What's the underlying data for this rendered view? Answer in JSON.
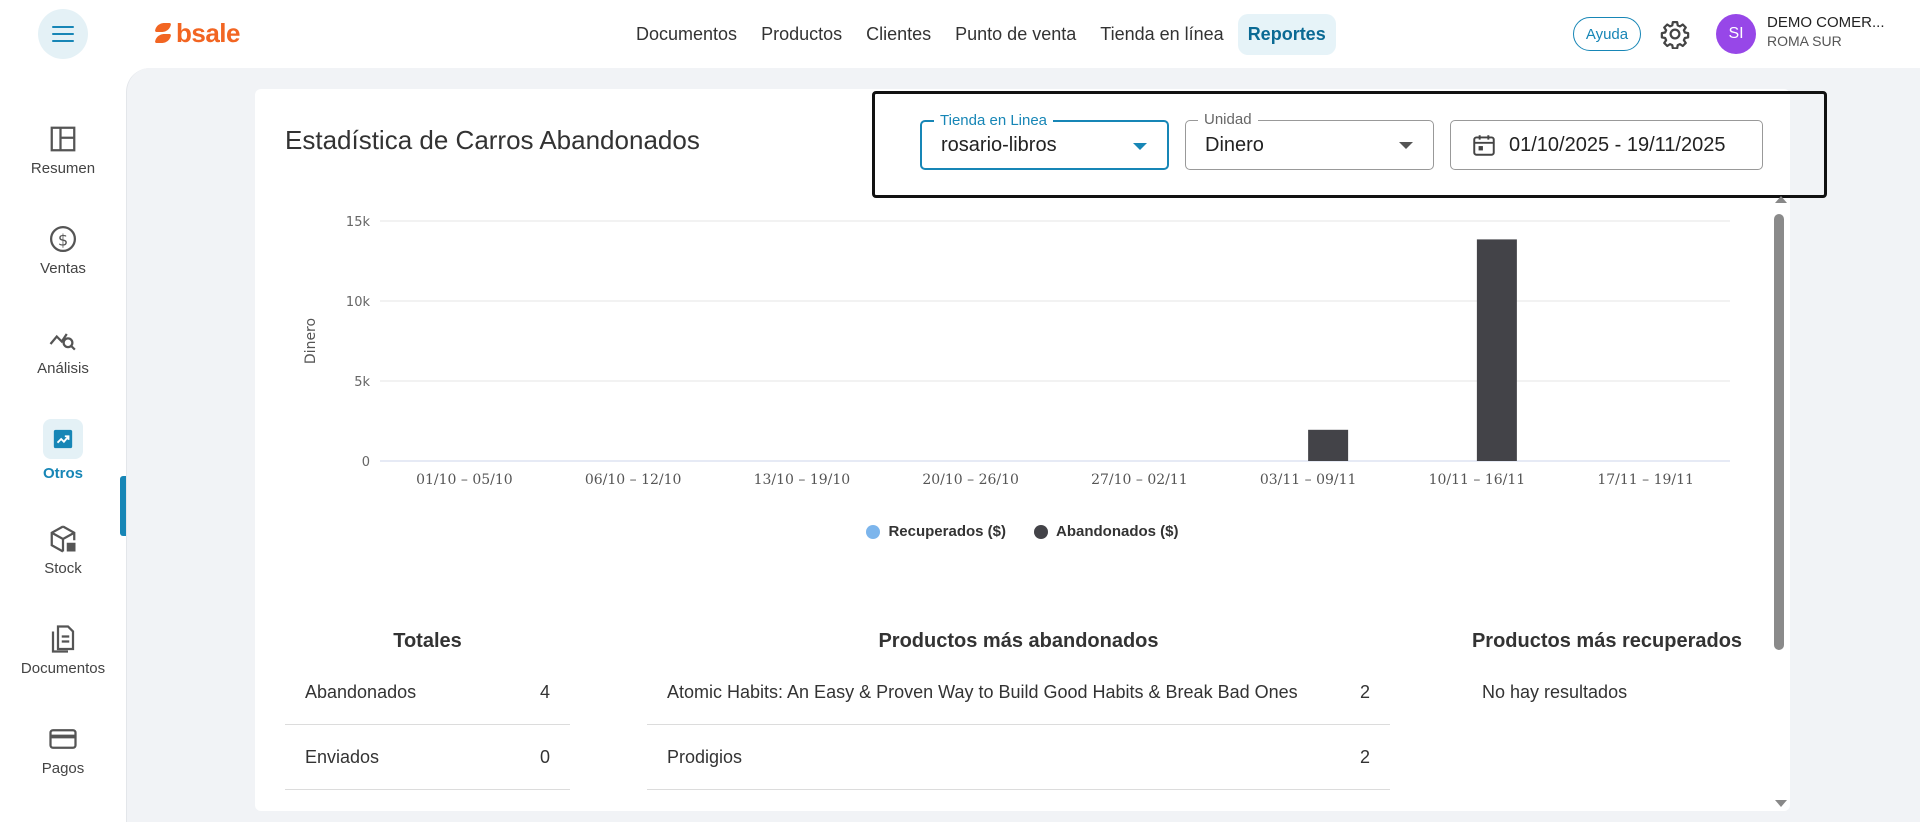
{
  "header": {
    "logo_text": "bsale",
    "nav": [
      "Documentos",
      "Productos",
      "Clientes",
      "Punto de venta",
      "Tienda en línea",
      "Reportes"
    ],
    "active_nav": "Reportes",
    "help_label": "Ayuda",
    "avatar_initials": "SI",
    "user_name": "DEMO COMER...",
    "user_branch": "ROMA SUR"
  },
  "sidebar": {
    "items": [
      {
        "label": "Resumen",
        "icon": "layout-icon"
      },
      {
        "label": "Ventas",
        "icon": "dollar-icon"
      },
      {
        "label": "Análisis",
        "icon": "analysis-icon"
      },
      {
        "label": "Otros",
        "icon": "trend-icon"
      },
      {
        "label": "Stock",
        "icon": "box-icon"
      },
      {
        "label": "Documentos",
        "icon": "document-icon"
      },
      {
        "label": "Pagos",
        "icon": "card-icon"
      }
    ],
    "active": "Otros"
  },
  "page": {
    "title": "Estadística de Carros Abandonados"
  },
  "filters": {
    "store_label": "Tienda en Linea",
    "store_value": "rosario-libros",
    "unit_label": "Unidad",
    "unit_value": "Dinero",
    "date_range": "01/10/2025 - 19/11/2025"
  },
  "chart_data": {
    "type": "bar",
    "ylabel": "Dinero",
    "ylim": [
      0,
      15000
    ],
    "yticks": [
      0,
      5000,
      10000,
      15000
    ],
    "ytick_labels": [
      "0",
      "5k",
      "10k",
      "15k"
    ],
    "grid": true,
    "legend_position": "bottom",
    "categories": [
      "01/10 – 05/10",
      "06/10 – 12/10",
      "13/10 – 19/10",
      "20/10 – 26/10",
      "27/10 – 02/11",
      "03/11 – 09/11",
      "10/11 – 16/11",
      "17/11 – 19/11"
    ],
    "series": [
      {
        "name": "Recuperados ($)",
        "color": "#7cb5ec",
        "values": [
          0,
          0,
          0,
          0,
          0,
          0,
          0,
          0
        ]
      },
      {
        "name": "Abandonados ($)",
        "color": "#434348",
        "values": [
          0,
          0,
          0,
          0,
          0,
          1950,
          13850,
          0
        ]
      }
    ]
  },
  "tables": {
    "totales": {
      "title": "Totales",
      "rows": [
        {
          "label": "Abandonados",
          "value": "4"
        },
        {
          "label": "Enviados",
          "value": "0"
        }
      ]
    },
    "abandonados": {
      "title": "Productos más abandonados",
      "rows": [
        {
          "label": "Atomic Habits: An Easy & Proven Way to Build Good Habits & Break Bad Ones",
          "value": "2"
        },
        {
          "label": "Prodigios",
          "value": "2"
        }
      ]
    },
    "recuperados": {
      "title": "Productos más recuperados",
      "empty_text": "No hay resultados"
    }
  }
}
